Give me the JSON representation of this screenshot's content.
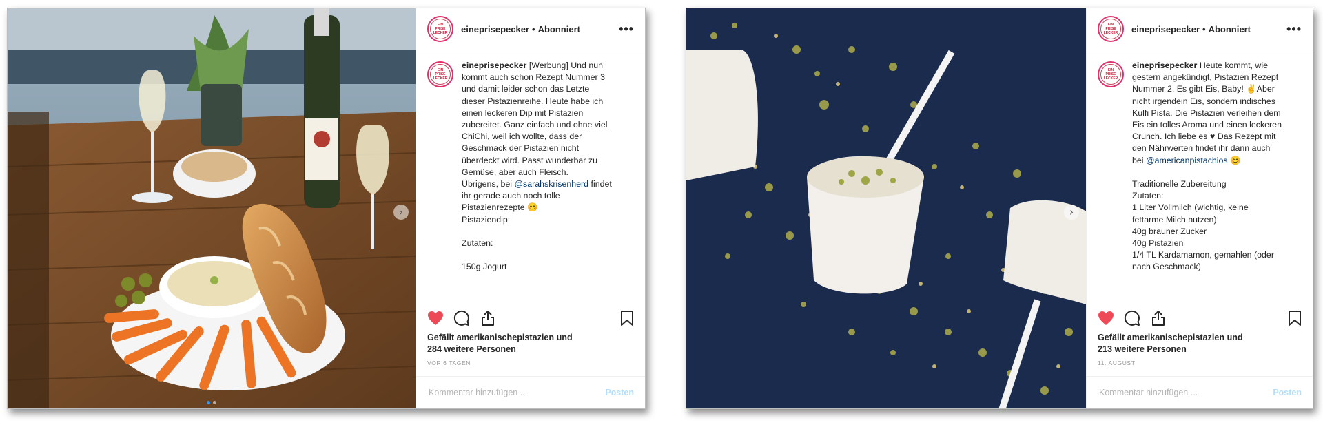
{
  "posts": [
    {
      "username": "eineprisepecker",
      "separator": "•",
      "follow_status": "Abonniert",
      "more_label": "•••",
      "avatar_text": [
        "EIN",
        "PRISE",
        "LECKER"
      ],
      "caption_username": "eineprisepecker",
      "caption_lines": [
        "[Werbung] Und nun",
        "kommt auch schon Rezept Nummer 3",
        "und damit leider schon das Letzte",
        "dieser Pistazienreihe. Heute habe ich",
        "einen leckeren Dip mit Pistazien",
        "zubereitet. Ganz einfach und ohne viel",
        "ChiChi, weil ich wollte, dass der",
        "Geschmack der Pistazien nicht",
        "überdeckt wird. Passt wunderbar zu",
        "Gemüse, aber auch Fleisch.",
        "Übrigens, bei ",
        "ihr gerade auch noch tolle",
        "Pistazienrezepte 😊",
        "Pistaziendip:",
        "",
        "Zutaten:",
        "",
        "150g Jogurt"
      ],
      "caption_mention": "@sarahskrisenherd",
      "caption_mention_after": " findet",
      "likes_line1": "Gefällt amerikanischepistazien und",
      "likes_line2": "284 weitere Personen",
      "date": "VOR 6 TAGEN",
      "comment_placeholder": "Kommentar hinzufügen ...",
      "post_label": "Posten",
      "next_arrow": "›",
      "carousel_dots": 2,
      "active_dot": 0
    },
    {
      "username": "eineprisepecker",
      "separator": "•",
      "follow_status": "Abonniert",
      "more_label": "•••",
      "avatar_text": [
        "EIN",
        "PRISE",
        "LECKER"
      ],
      "caption_username": "eineprisepecker",
      "caption_lines": [
        "Heute kommt, wie",
        "gestern angekündigt, Pistazien Rezept",
        "Nummer 2. Es gibt Eis, Baby! ✌️Aber",
        "nicht irgendein Eis, sondern indisches",
        "Kulfi Pista. Die Pistazien verleihen dem",
        "Eis ein tolles Aroma und einen leckeren",
        "Crunch. Ich liebe es ♥ Das Rezept mit",
        "den Nährwerten findet ihr dann auch",
        "bei ",
        "",
        "Traditionelle Zubereitung",
        "Zutaten:",
        "1 Liter Vollmilch (wichtig, keine",
        "fettarme Milch nutzen)",
        "40g brauner Zucker",
        "40g Pistazien",
        "1/4 TL Kardamamon, gemahlen (oder",
        "nach Geschmack)"
      ],
      "caption_mention": "@americanpistachios",
      "caption_mention_after": " 😊",
      "likes_line1": "Gefällt amerikanischepistazien und",
      "likes_line2": "213 weitere Personen",
      "date": "11. AUGUST",
      "comment_placeholder": "Kommentar hinzufügen ...",
      "post_label": "Posten",
      "next_arrow": "›"
    }
  ],
  "colors": {
    "heart": "#ed4956",
    "mention": "#003569",
    "post_button_disabled": "#b2dffc",
    "date": "#999999",
    "avatar_ring": "#e1306c",
    "photo2_background": "#1b2b4e"
  },
  "icons": [
    "heart-icon",
    "comment-icon",
    "share-icon",
    "bookmark-icon",
    "more-icon",
    "chevron-right-icon"
  ]
}
